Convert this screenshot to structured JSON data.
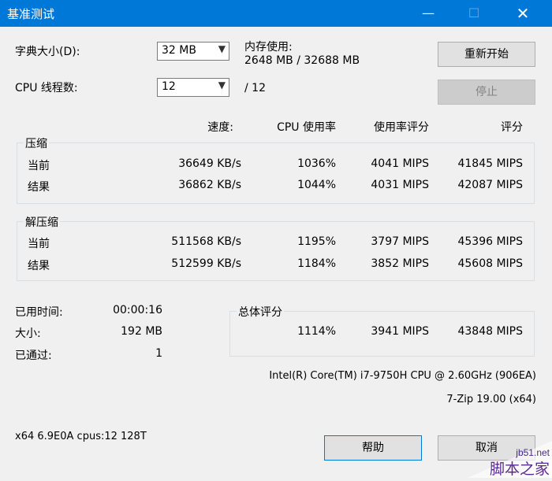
{
  "window": {
    "title": "基准测试",
    "min_glyph": "—",
    "max_glyph": "☐",
    "close_glyph": "✕"
  },
  "settings": {
    "dict_label": "字典大小(D):",
    "dict_value": "32 MB",
    "threads_label": "CPU 线程数:",
    "threads_value": "12",
    "threads_total": "/ 12",
    "memory_label": "内存使用:",
    "memory_value": "2648 MB / 32688 MB"
  },
  "buttons": {
    "restart": "重新开始",
    "stop": "停止",
    "help": "帮助",
    "cancel": "取消"
  },
  "headers": {
    "speed": "速度:",
    "cpu_usage": "CPU 使用率",
    "rating_usage": "使用率评分",
    "rating": "评分"
  },
  "compress": {
    "title": "压缩",
    "rows": [
      {
        "label": "当前",
        "speed": "36649 KB/s",
        "usage": "1036%",
        "rpu": "4041 MIPS",
        "rating": "41845 MIPS"
      },
      {
        "label": "结果",
        "speed": "36862 KB/s",
        "usage": "1044%",
        "rpu": "4031 MIPS",
        "rating": "42087 MIPS"
      }
    ]
  },
  "decompress": {
    "title": "解压缩",
    "rows": [
      {
        "label": "当前",
        "speed": "511568 KB/s",
        "usage": "1195%",
        "rpu": "3797 MIPS",
        "rating": "45396 MIPS"
      },
      {
        "label": "结果",
        "speed": "512599 KB/s",
        "usage": "1184%",
        "rpu": "3852 MIPS",
        "rating": "45608 MIPS"
      }
    ]
  },
  "stats": {
    "elapsed_label": "已用时间:",
    "elapsed_value": "00:00:16",
    "size_label": "大小:",
    "size_value": "192 MB",
    "passes_label": "已通过:",
    "passes_value": "1"
  },
  "total": {
    "title": "总体评分",
    "usage": "1114%",
    "rpu": "3941 MIPS",
    "rating": "43848 MIPS"
  },
  "cpu_info": "Intel(R) Core(TM) i7-9750H CPU @ 2.60GHz (906EA)",
  "version": "7-Zip 19.00 (x64)",
  "sys_info": "x64 6.9E0A cpus:12 128T",
  "watermark": {
    "site": "jb51.net",
    "name": "脚本之家"
  }
}
